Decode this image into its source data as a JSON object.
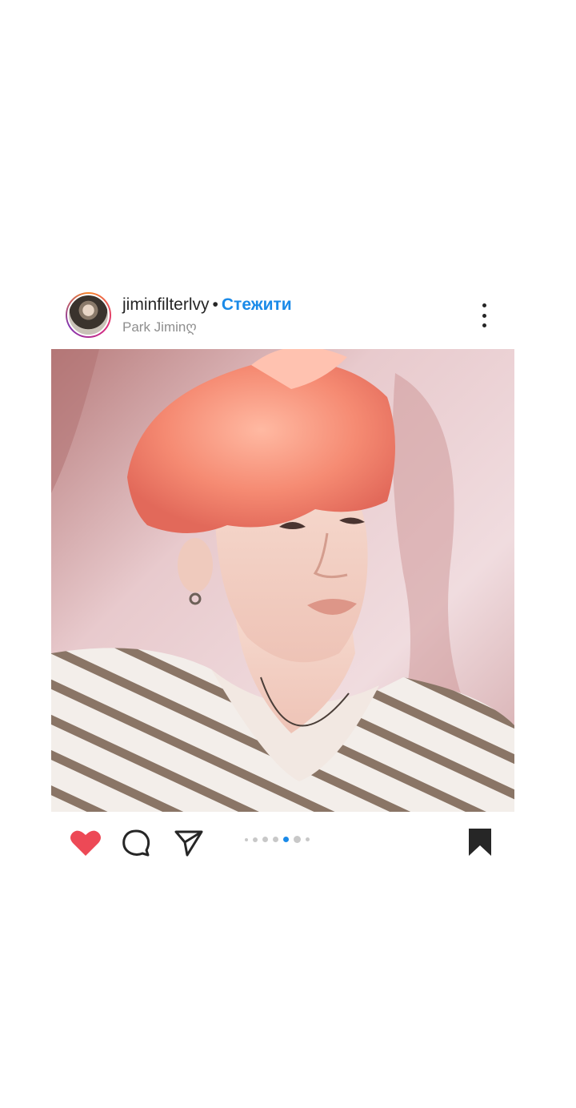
{
  "post": {
    "username": "jiminfilterlvy",
    "separator": "•",
    "follow_label": "Стежити",
    "location": "Park Jiminღ",
    "photo_alt": "",
    "liked": true,
    "carousel": {
      "total": 7,
      "active_index": 5
    },
    "colors": {
      "like": "#ed4956",
      "follow": "#1a8ae8",
      "active_dot": "#1a8ae8",
      "icon": "#262626"
    }
  },
  "icons": {
    "more": "more-options-icon",
    "like": "heart-icon",
    "comment": "comment-icon",
    "share": "send-icon",
    "save": "bookmark-icon"
  }
}
